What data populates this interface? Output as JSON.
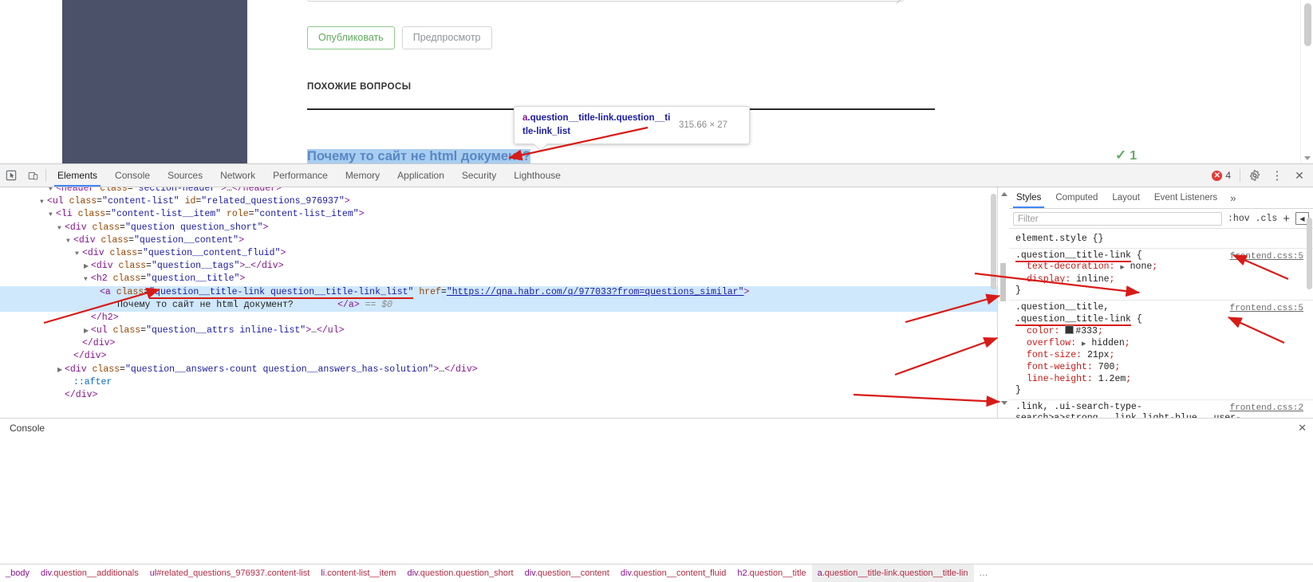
{
  "page": {
    "buttons": {
      "publish": "Опубликовать",
      "preview": "Предпросмотр"
    },
    "section_heading": "ПОХОЖИЕ ВОПРОСЫ",
    "question_title": "Почему то сайт не html документ?",
    "answers_count": "1",
    "answers_check": "✓",
    "inspector_tooltip": {
      "tag": "a",
      "classes": ".question__title-link.question__ti tle-link_list",
      "dimensions": "315.66 × 27"
    }
  },
  "devtools": {
    "tabs": [
      {
        "label": "Elements",
        "active": true
      },
      {
        "label": "Console",
        "active": false
      },
      {
        "label": "Sources",
        "active": false
      },
      {
        "label": "Network",
        "active": false
      },
      {
        "label": "Performance",
        "active": false
      },
      {
        "label": "Memory",
        "active": false
      },
      {
        "label": "Application",
        "active": false
      },
      {
        "label": "Security",
        "active": false
      },
      {
        "label": "Lighthouse",
        "active": false
      }
    ],
    "error_count": "4",
    "error_glyph": "✕",
    "settings_glyph": "⚙",
    "kebab_glyph": "⋮",
    "close_glyph": "✕",
    "dom_lines": [
      {
        "indent": 5,
        "tri": "open",
        "html": "<span class=\"pt\">&lt;header</span> <span class=\"at\">class</span>=<span class=\"av\">\"section-header\"</span><span class=\"pt\">&gt;</span><span class=\"txt\">…</span><span class=\"pt\">&lt;/header&gt;</span>"
      },
      {
        "indent": 4,
        "tri": "open",
        "html": "<span class=\"pt\">&lt;ul</span> <span class=\"at\">class</span>=<span class=\"av\">\"content-list\"</span> <span class=\"at\">id</span>=<span class=\"av\">\"related_questions_976937\"</span><span class=\"pt\">&gt;</span>"
      },
      {
        "indent": 5,
        "tri": "open",
        "html": "<span class=\"pt\">&lt;li</span> <span class=\"at\">class</span>=<span class=\"av\">\"content-list__item\"</span> <span class=\"at\">role</span>=<span class=\"av\">\"content-list_item\"</span><span class=\"pt\">&gt;</span>"
      },
      {
        "indent": 6,
        "tri": "open",
        "html": "<span class=\"pt\">&lt;div</span> <span class=\"at\">class</span>=<span class=\"av\">\"question question_short\"</span><span class=\"pt\">&gt;</span>"
      },
      {
        "indent": 7,
        "tri": "open",
        "html": "<span class=\"pt\">&lt;div</span> <span class=\"at\">class</span>=<span class=\"av\">\"question__content\"</span><span class=\"pt\">&gt;</span>"
      },
      {
        "indent": 8,
        "tri": "open",
        "html": "<span class=\"pt\">&lt;div</span> <span class=\"at\">class</span>=<span class=\"av\">\"question__content_fluid\"</span><span class=\"pt\">&gt;</span>"
      },
      {
        "indent": 9,
        "tri": "closed",
        "html": "<span class=\"pt\">&lt;div</span> <span class=\"at\">class</span>=<span class=\"av\">\"question__tags\"</span><span class=\"pt\">&gt;</span><span class=\"txt\">…</span><span class=\"pt\">&lt;/div&gt;</span>"
      },
      {
        "indent": 9,
        "tri": "open",
        "html": "<span class=\"pt\">&lt;h2</span> <span class=\"at\">class</span>=<span class=\"av\">\"question__title\"</span><span class=\"pt\">&gt;</span>"
      },
      {
        "indent": 10,
        "tri": "none",
        "selected": true,
        "html": "<span class=\"pt\">&lt;a</span> <span class=\"at\">class</span>=<span class=\"av attr-hl\">\"question__title-link question__title-link_list\"</span> <span class=\"at\">href</span>=<span class=\"av ulined\">\"https://qna.habr.com/q/977033?from=questions_similar\"</span><span class=\"pt\">&gt;</span>"
      },
      {
        "indent": 12,
        "tri": "none",
        "selected": true,
        "html": "<span class=\"txt\">Почему то сайт не html документ?</span>        <span class=\"pt\">&lt;/a&gt;</span> <span class=\"dollar\">== $0</span>"
      },
      {
        "indent": 9,
        "tri": "none",
        "html": "<span class=\"pt\">&lt;/h2&gt;</span>"
      },
      {
        "indent": 9,
        "tri": "closed",
        "html": "<span class=\"pt\">&lt;ul</span> <span class=\"at\">class</span>=<span class=\"av\">\"question__attrs inline-list\"</span><span class=\"pt\">&gt;</span><span class=\"txt\">…</span><span class=\"pt\">&lt;/ul&gt;</span>"
      },
      {
        "indent": 8,
        "tri": "none",
        "html": "<span class=\"pt\">&lt;/div&gt;</span>"
      },
      {
        "indent": 7,
        "tri": "none",
        "html": "<span class=\"pt\">&lt;/div&gt;</span>"
      },
      {
        "indent": 6,
        "tri": "closed",
        "html": "<span class=\"pt\">&lt;div</span> <span class=\"at\">class</span>=<span class=\"av\">\"question__answers-count question__answers_has-solution\"</span><span class=\"pt\">&gt;</span><span class=\"txt\">…</span><span class=\"pt\">&lt;/div&gt;</span>"
      },
      {
        "indent": 7,
        "tri": "none",
        "html": "<span class=\"pse\">::after</span>"
      },
      {
        "indent": 6,
        "tri": "none",
        "html": "<span class=\"pt\">&lt;/div&gt;</span>"
      }
    ],
    "breadcrumbs": [
      {
        "html": "<span class=\"c-tag\">_body</span>",
        "active": false
      },
      {
        "html": "<span class=\"c-tag\">div</span><span class=\"c-cls\">.question__additionals</span>",
        "active": false
      },
      {
        "html": "<span class=\"c-tag\">ul</span><span class=\"c-id\">#related_questions_976937</span><span class=\"c-cls\">.content-list</span>",
        "active": false
      },
      {
        "html": "<span class=\"c-tag\">li</span><span class=\"c-cls\">.content-list__item</span>",
        "active": false
      },
      {
        "html": "<span class=\"c-tag\">div</span><span class=\"c-cls\">.question.question_short</span>",
        "active": false
      },
      {
        "html": "<span class=\"c-tag\">div</span><span class=\"c-cls\">.question__content</span>",
        "active": false
      },
      {
        "html": "<span class=\"c-tag\">div</span><span class=\"c-cls\">.question__content_fluid</span>",
        "active": false
      },
      {
        "html": "<span class=\"c-tag\">h2</span><span class=\"c-cls\">.question__title</span>",
        "active": false
      },
      {
        "html": "<span class=\"c-tag\">a</span><span class=\"c-cls\">.question__title-link.question__title-lin</span>",
        "active": true
      },
      {
        "html": "<span class=\"ell\">…</span>",
        "active": false
      }
    ],
    "styles": {
      "tabs": [
        {
          "label": "Styles",
          "active": true
        },
        {
          "label": "Computed",
          "active": false
        },
        {
          "label": "Layout",
          "active": false
        },
        {
          "label": "Event Listeners",
          "active": false
        }
      ],
      "more_glyph": "»",
      "filter_placeholder": "Filter",
      "hov_label": ":hov",
      "cls_label": ".cls",
      "plus_label": "+",
      "sidebar_toggle_glyph": "◀",
      "rules": [
        {
          "selector_html": "<span class=\"sel\">element.style</span> <span class=\"brace\">{</span>",
          "source": "",
          "declarations": [],
          "close": "}"
        },
        {
          "selector_html": "<span class=\"sel u\">.question__title-link</span> <span class=\"brace\">{</span>",
          "source": "frontend.css:5",
          "declarations": [
            {
              "name": "text-decoration",
              "toggle": true,
              "value": "none",
              "value_class": "val-dark"
            },
            {
              "name": "display",
              "toggle": false,
              "value": "inline",
              "value_class": "val-dark"
            }
          ],
          "close": "}"
        },
        {
          "selector_html": "<span class=\"sel\">.question__title,</span><br><span class=\"sel u\">.question__title-link</span> <span class=\"brace\">{</span>",
          "source": "frontend.css:5",
          "declarations": [
            {
              "name": "color",
              "toggle": false,
              "value": "#333",
              "value_class": "val-dark",
              "swatch": true
            },
            {
              "name": "overflow",
              "toggle": true,
              "value": "hidden",
              "value_class": "val-dark"
            },
            {
              "name": "font-size",
              "toggle": false,
              "value": "21px",
              "value_class": "val-dark"
            },
            {
              "name": "font-weight",
              "toggle": false,
              "value": "700",
              "value_class": "val-dark"
            },
            {
              "name": "line-height",
              "toggle": false,
              "value": "1.2em",
              "value_class": "val-dark"
            }
          ],
          "close": "}"
        },
        {
          "selector_html": "<span class=\"sel\">.link, .ui-search-type-</span><br><span class=\"sel\">search&gt;a&gt;strong, .link light-blue, .user-</span>",
          "source": "frontend.css:2",
          "declarations": [],
          "close": ""
        }
      ]
    },
    "drawer": {
      "tab": "Console",
      "close_glyph": "✕"
    }
  }
}
